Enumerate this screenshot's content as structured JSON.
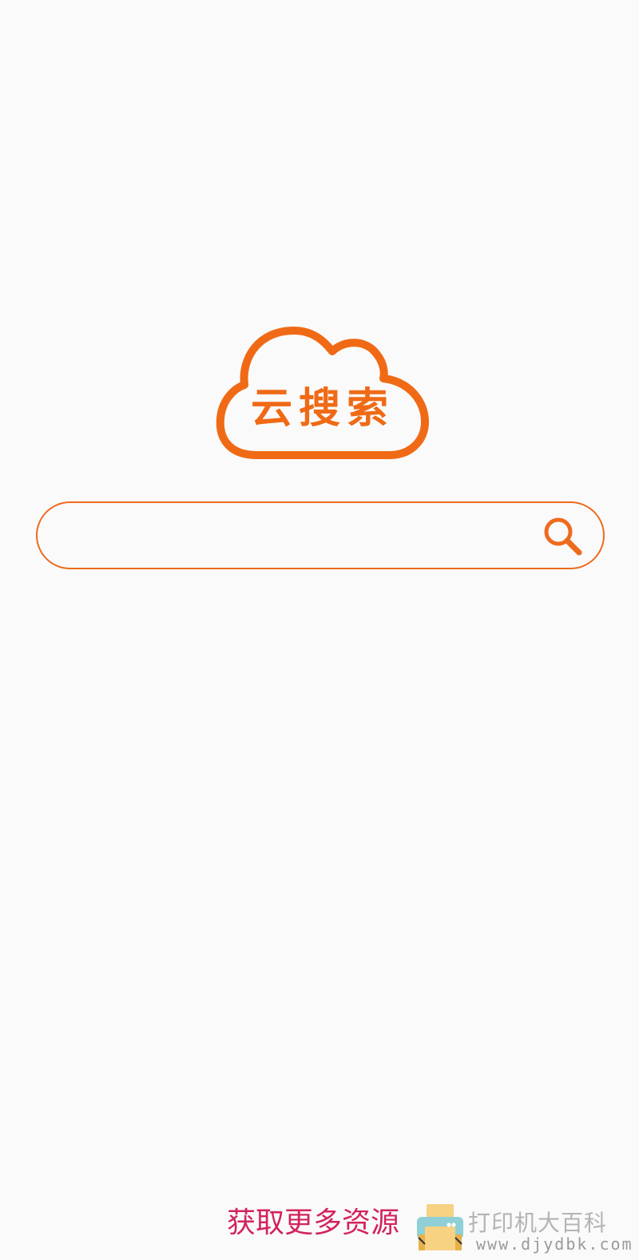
{
  "logo": {
    "text": "云搜索",
    "icon": "cloud-icon"
  },
  "search": {
    "value": "",
    "placeholder": "",
    "button_icon": "search-icon"
  },
  "footer": {
    "link_text": "获取更多资源"
  },
  "watermark": {
    "icon": "printer-icon",
    "site_name": "打印机大百科",
    "url": "www.djydbk.com"
  },
  "colors": {
    "background": "#fafafa",
    "accent": "#f06a16",
    "footer_link": "#d2245c",
    "watermark": "#b4b4b4"
  }
}
